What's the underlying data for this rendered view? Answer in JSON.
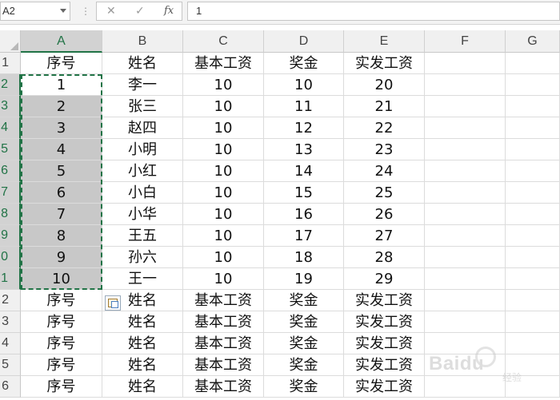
{
  "formula_bar": {
    "name_box": "A2",
    "cancel_glyph": "✕",
    "enter_glyph": "✓",
    "fx_label": "fx",
    "formula_value": "1"
  },
  "columns": [
    "A",
    "B",
    "C",
    "D",
    "E",
    "F",
    "G"
  ],
  "rows": [
    "1",
    "2",
    "3",
    "4",
    "5",
    "6",
    "7",
    "8",
    "9",
    "0",
    "1",
    "2",
    "3",
    "4",
    "5",
    "6"
  ],
  "cells": [
    [
      "序号",
      "姓名",
      "基本工资",
      "奖金",
      "实发工资"
    ],
    [
      "1",
      "李一",
      "10",
      "10",
      "20"
    ],
    [
      "2",
      "张三",
      "10",
      "11",
      "21"
    ],
    [
      "3",
      "赵四",
      "10",
      "12",
      "22"
    ],
    [
      "4",
      "小明",
      "10",
      "13",
      "23"
    ],
    [
      "5",
      "小红",
      "10",
      "14",
      "24"
    ],
    [
      "6",
      "小白",
      "10",
      "15",
      "25"
    ],
    [
      "7",
      "小华",
      "10",
      "16",
      "26"
    ],
    [
      "8",
      "王五",
      "10",
      "17",
      "27"
    ],
    [
      "9",
      "孙六",
      "10",
      "18",
      "28"
    ],
    [
      "10",
      "王一",
      "10",
      "19",
      "29"
    ],
    [
      "序号",
      "姓名",
      "基本工资",
      "奖金",
      "实发工资"
    ],
    [
      "序号",
      "姓名",
      "基本工资",
      "奖金",
      "实发工资"
    ],
    [
      "序号",
      "姓名",
      "基本工资",
      "奖金",
      "实发工资"
    ],
    [
      "序号",
      "姓名",
      "基本工资",
      "奖金",
      "实发工资"
    ],
    [
      "序号",
      "姓名",
      "基本工资",
      "奖金",
      "实发工资"
    ]
  ],
  "selection": {
    "column": "A",
    "range_text": "A2:A11",
    "highlight_color": "#c8c8c8",
    "marquee_color": "#217346"
  },
  "icons": {
    "paste_options": "paste-options-icon",
    "namebox_dropdown": "chevron-down-icon"
  },
  "watermark": {
    "brand": "Baidu",
    "sub": "经验"
  }
}
